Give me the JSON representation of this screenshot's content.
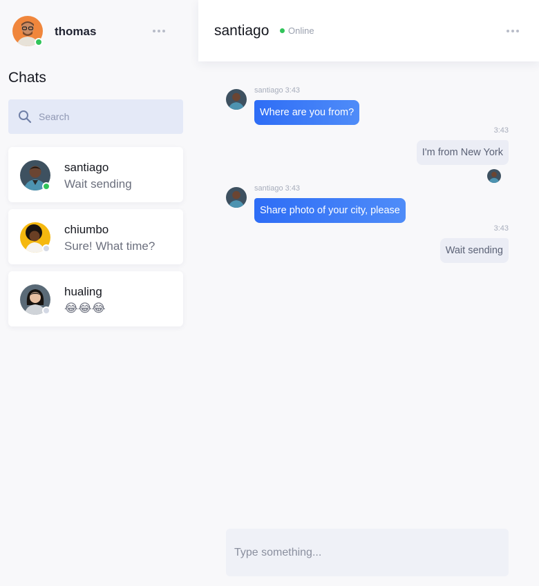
{
  "colors": {
    "online": "#31c45a",
    "offline": "#d3d8e4",
    "accent": "#2e6df6",
    "search_bg": "#e4e9f7"
  },
  "sidebar": {
    "user": {
      "name": "thomas",
      "status": "online"
    },
    "title": "Chats",
    "search": {
      "placeholder": "Search",
      "value": ""
    },
    "chats": [
      {
        "name": "santiago",
        "last_message": "Wait sending",
        "status": "online"
      },
      {
        "name": "chiumbo",
        "last_message": "Sure! What time?",
        "status": "offline"
      },
      {
        "name": "hualing",
        "last_message": "😂😂😂",
        "status": "offline"
      }
    ]
  },
  "header": {
    "contact_name": "santiago",
    "status_text": "Online"
  },
  "messages": [
    {
      "direction": "in",
      "meta": "santiago 3:43",
      "text": "Where are you from?"
    },
    {
      "direction": "out",
      "meta": "3:43",
      "text": "I'm from New York"
    },
    {
      "direction": "in",
      "meta": "santiago 3:43",
      "text": "Share photo of your city, please"
    },
    {
      "direction": "out",
      "meta": "3:43",
      "text": "Wait sending"
    }
  ],
  "composer": {
    "placeholder": "Type something...",
    "value": ""
  }
}
